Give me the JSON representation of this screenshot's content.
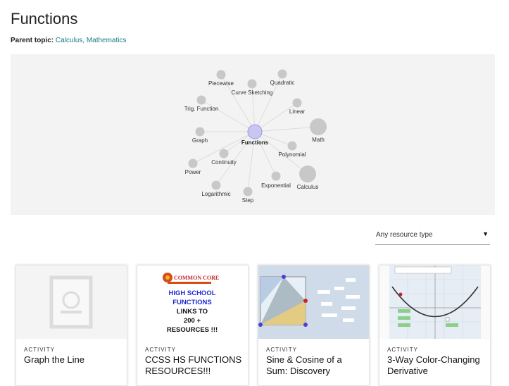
{
  "page": {
    "title": "Functions",
    "parent_label": "Parent topic:",
    "parent_links": "Calculus, Mathematics"
  },
  "graph": {
    "center": "Functions",
    "nodes": [
      "Piecewise",
      "Curve Sketching",
      "Quadratic",
      "Trig. Function",
      "Linear",
      "Graph",
      "Math",
      "Continuity",
      "Polynomial",
      "Power",
      "Exponential",
      "Calculus",
      "Logarithmic",
      "Step"
    ]
  },
  "filter": {
    "value": "Any resource type",
    "arrow": "▼"
  },
  "cards": [
    {
      "kind": "ACTIVITY",
      "title": "Graph the Line",
      "thumb": "placeholder-doc-icon"
    },
    {
      "kind": "ACTIVITY",
      "title": "CCSS HS FUNCTIONS RESOURCES!!!",
      "thumb": "common-core-banner",
      "thumb_text": {
        "brand": "COMMON CORE",
        "line1": "HIGH SCHOOL",
        "line2": "FUNCTIONS",
        "line3": "LINKS TO",
        "line4": "200 +",
        "line5": "RESOURCES !!!"
      }
    },
    {
      "kind": "ACTIVITY",
      "title": "Sine & Cosine of a Sum: Discovery",
      "thumb": "geometry-applet"
    },
    {
      "kind": "ACTIVITY",
      "title": "3-Way Color-Changing Derivative",
      "thumb": "parabola-applet"
    }
  ],
  "colors": {
    "link": "#1d7a85",
    "panel": "#f3f3f3",
    "node": "#c8c8c8",
    "center_node": "#c9c6f2"
  }
}
